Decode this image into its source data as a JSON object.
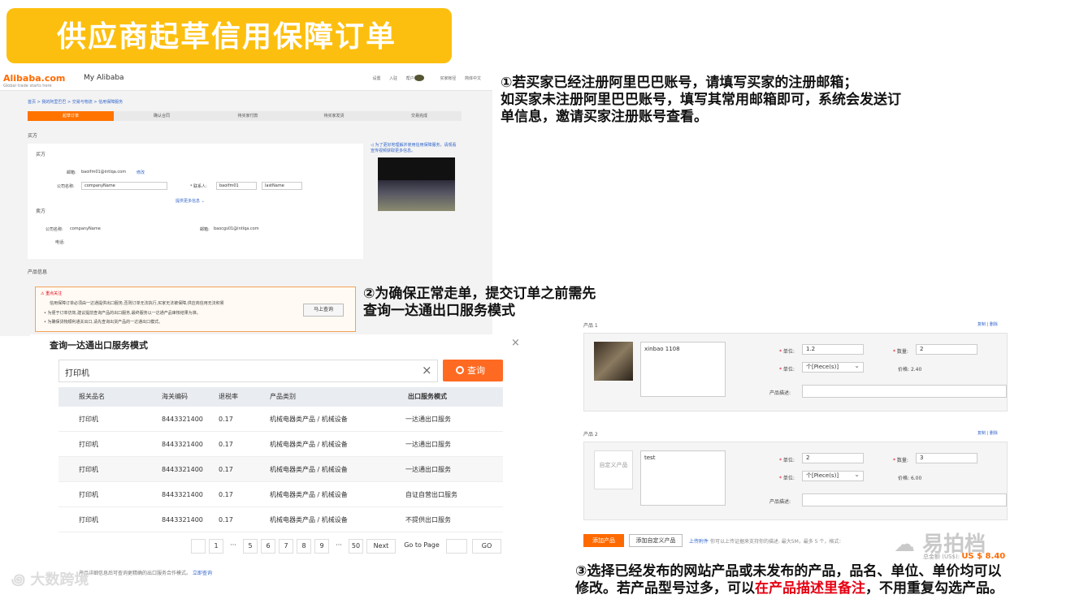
{
  "slide_title": "供应商起草信用保障订单",
  "notes": {
    "note1_lines": [
      "①若买家已经注册阿里巴巴账号，请填写买家的注册邮箱；",
      "如买家未注册阿里巴巴账号，填写其常用邮箱即可，系统会发送订",
      "单信息，邀请买家注册账号查看。"
    ],
    "note2_lines": [
      "②为确保正常走单，提交订单之前需先",
      "查询一达通出口服务模式"
    ],
    "note3_line1": "③选择已经发布的网站产品或未发布的产品，品名、单位、单价均可以",
    "note3_line2_pre": "修改。若产品型号过多，可以",
    "note3_line2_red": "在产品描述里备注",
    "note3_line2_post": "，不用重复勾选产品。"
  },
  "alibaba": {
    "logo": "Alibaba.com",
    "logo_tag": "Global trade starts here",
    "my_alibaba": "My Alibaba",
    "header_links": [
      "设置",
      "入驻",
      "帮户",
      "买家帐径",
      "简体中文"
    ],
    "breadcrumb": "首页 > 我的阿里巴巴 > 交易与物流 > 信用保障服务",
    "steps": [
      "起草订单",
      "确认合同",
      "待买家付款",
      "待买家发货",
      "交易完成"
    ],
    "section_buyer_top": "买方",
    "buyer_label": "买方",
    "email_label": "邮箱:",
    "email_value": "baoifm01@intlqa.com",
    "email_edit": "修改",
    "company_label": "公司名称:",
    "company_value": "companyName",
    "contact_label": "* 联系人:",
    "contact_first": "baoifm01",
    "contact_last": "lastName",
    "more_info": "提供更多信息",
    "seller_label": "卖方",
    "seller_company_label": "公司名称:",
    "seller_company_value": "companyName",
    "seller_email_label": "邮箱:",
    "seller_email_value": "baocgs01@intlqa.com",
    "seller_phone_label": "电话:",
    "video_tip": "为了更好地理解并使用信用保障服务，请观看宣传视频获取更多信息。",
    "product_info": "产品信息",
    "warn_title": "重点关注",
    "warn_lines": [
      "信用保障订单必须由一达通提供出口服务,否则订单无法执行,买家无法被保障,供应商信用无法积累",
      "为便于订单仿效,建议提前查询产品的出口服务,最终服务以一达通产品审核结果为准。",
      "为确保货物顺利通关出口,请先查询出货产品的一达通出口模式。"
    ],
    "query_now": "马上查询"
  },
  "dialog": {
    "title": "查询一达通出口服务模式",
    "search_value": "打印机",
    "search_button": "查询",
    "columns": [
      "报关品名",
      "海关编码",
      "退税率",
      "产品类别",
      "出口服务模式"
    ],
    "rows": [
      [
        "打印机",
        "8443321400",
        "0.17",
        "机械电器类产品 / 机械设备",
        "一达通出口服务"
      ],
      [
        "打印机",
        "8443321400",
        "0.17",
        "机械电器类产品 / 机械设备",
        "一达通出口服务"
      ],
      [
        "打印机",
        "8443321400",
        "0.17",
        "机械电器类产品 / 机械设备",
        "一达通出口服务"
      ],
      [
        "打印机",
        "8443321400",
        "0.17",
        "机械电器类产品 / 机械设备",
        "自证自营出口服务"
      ],
      [
        "打印机",
        "8443321400",
        "0.17",
        "机械电器类产品 / 机械设备",
        "不提供出口服务"
      ]
    ],
    "pager": [
      "1",
      "···",
      "5",
      "6",
      "7",
      "8",
      "9",
      "···",
      "50",
      "Next",
      "Go to Page",
      "GO"
    ],
    "footer_text": "产品详细信息后可查询更精确的出口服务合作模式。",
    "footer_link": "立即查询"
  },
  "products": {
    "p1_label": "产品 1",
    "p2_label": "产品 2",
    "actions": "复制 | 删除",
    "p1_name": "xinbao 1108",
    "p2_name": "test",
    "custom_thumb": "自定义产品",
    "unit_label": "单位:",
    "qty_label": "数量:",
    "unit_sel_label": "单位:",
    "price_label": "价格:",
    "desc_label": "产品描述:",
    "p1_unit_price": "1.2",
    "p1_qty": "2",
    "p1_unit": "个[Piece(s)]",
    "p1_price": "2.40",
    "p2_unit_price": "2",
    "p2_qty": "3",
    "p2_unit": "个[Piece(s)]",
    "p2_price": "6.00",
    "add_product": "添加产品",
    "add_custom": "添加自定义产品",
    "upload_link": "上传附件",
    "upload_hint": "你可以上传证据来支持你的描述. 最大5M，最多 5 个，格式：",
    "total_label": "总金额 (US$):",
    "total_value": "US $ 8.40"
  },
  "watermarks": {
    "wechat": "易拍档",
    "bottom_left": "大数跨境"
  }
}
